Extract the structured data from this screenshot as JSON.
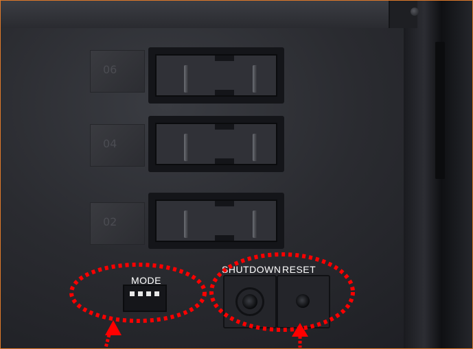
{
  "slots": [
    {
      "label": "06"
    },
    {
      "label": "04"
    },
    {
      "label": "02"
    }
  ],
  "mode_label": "MODE",
  "shutdown_label": "SHUTDOWN",
  "reset_label": "RESET",
  "colors": {
    "highlight": "#ff0000",
    "frame_border": "#e07a2a"
  }
}
